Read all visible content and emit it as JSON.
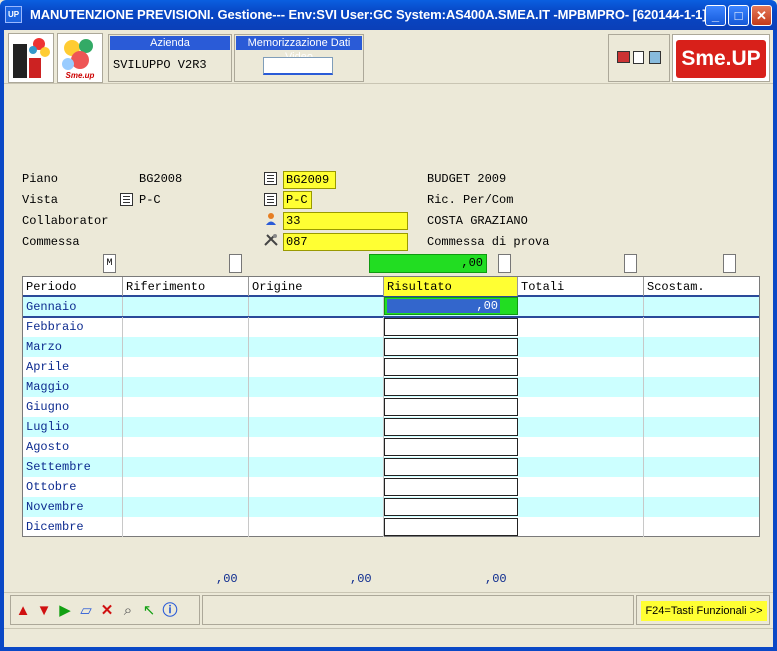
{
  "window": {
    "title": "MANUTENZIONE PREVISIONI.  Gestione--- Env:SVI User:GC System:AS400A.SMEA.IT -MPBMPRO- [620144-1-1]",
    "app_icon": "UP",
    "minimize": "_",
    "maximize": "□",
    "close": "✕"
  },
  "header": {
    "azienda_caption": "Azienda",
    "azienda_value": "SVILUPPO V2R3",
    "memo_caption": "Memorizzazione Dati Video",
    "memo_value": "",
    "brand": "Sme.UP",
    "logo2_text": "Sme.up"
  },
  "form": {
    "piano_label": "Piano",
    "piano_value": "BG2008",
    "piano_target": "BG2009",
    "piano_desc": "BUDGET 2009",
    "vista_label": "Vista",
    "vista_value": "P-C",
    "vista_target": "P-C",
    "vista_desc": "Ric. Per/Com",
    "collaborator_label": "Collaborator",
    "collaborator_value": "33",
    "collaborator_desc": "COSTA GRAZIANO",
    "commessa_label": "Commessa",
    "commessa_value": "087",
    "commessa_desc": "Commessa di prova",
    "m_box": "M",
    "green_total": ",00"
  },
  "grid": {
    "columns": [
      "Periodo",
      "Riferimento",
      "Origine",
      "Risultato",
      "Totali",
      "Scostam."
    ],
    "selected_value": ",00",
    "rows": [
      "Gennaio",
      "Febbraio",
      "Marzo",
      "Aprile",
      "Maggio",
      "Giugno",
      "Luglio",
      "Agosto",
      "Settembre",
      "Ottobre",
      "Novembre",
      "Dicembre"
    ]
  },
  "totals": {
    "riferimento": ",00",
    "origine": ",00",
    "risultato": ",00"
  },
  "bottom": {
    "f24_label": "F24=Tasti Funzionali >>",
    "icons": [
      "arrow-up-icon",
      "arrow-down-icon",
      "play-icon",
      "eraser-icon",
      "delete-icon",
      "search-icon",
      "back-icon",
      "info-icon"
    ]
  }
}
